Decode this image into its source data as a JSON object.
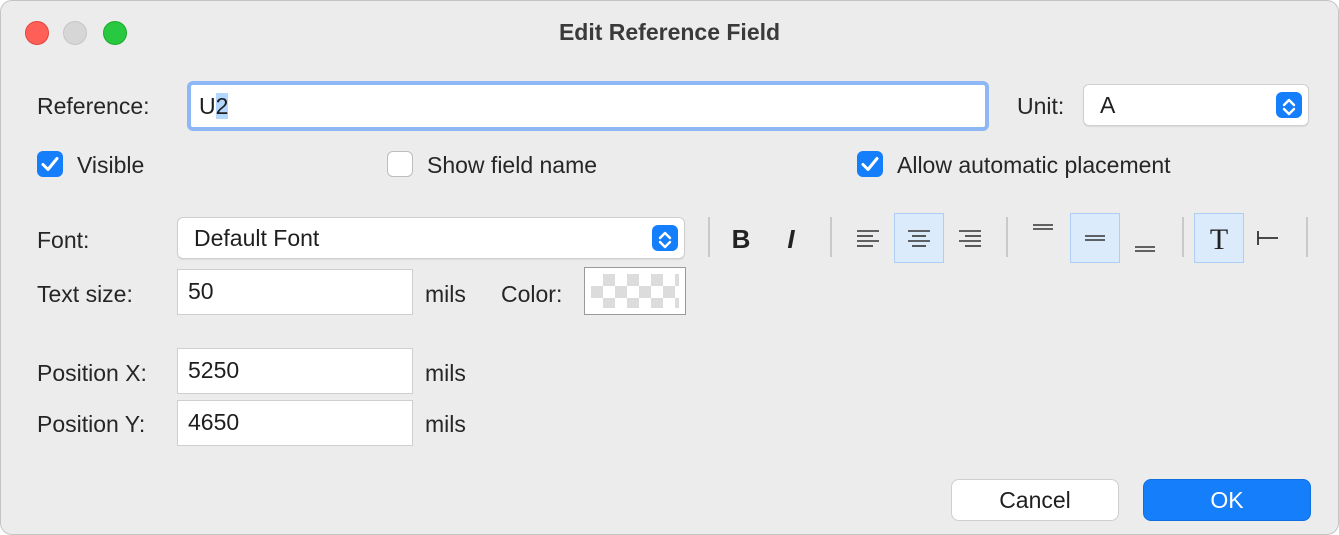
{
  "window": {
    "title": "Edit Reference Field"
  },
  "reference": {
    "label": "Reference:",
    "value_prefix": "U",
    "value_selected": "2"
  },
  "unit": {
    "label": "Unit:",
    "value": "A"
  },
  "checkboxes": {
    "visible": {
      "label": "Visible",
      "checked": true
    },
    "show_field_name": {
      "label": "Show field name",
      "checked": false
    },
    "auto_placement": {
      "label": "Allow automatic placement",
      "checked": true
    }
  },
  "font": {
    "label": "Font:",
    "value": "Default Font"
  },
  "text_size": {
    "label": "Text size:",
    "value": "50",
    "unit": "mils"
  },
  "color": {
    "label": "Color:"
  },
  "position_x": {
    "label": "Position X:",
    "value": "5250",
    "unit": "mils"
  },
  "position_y": {
    "label": "Position Y:",
    "value": "4650",
    "unit": "mils"
  },
  "toolbar": {
    "bold": "B",
    "italic": "I",
    "text_mode": "T"
  },
  "buttons": {
    "cancel": "Cancel",
    "ok": "OK"
  },
  "colors": {
    "accent": "#157efb",
    "focus_ring": "#8db8f5",
    "active_toggle": "#dcebfb"
  }
}
